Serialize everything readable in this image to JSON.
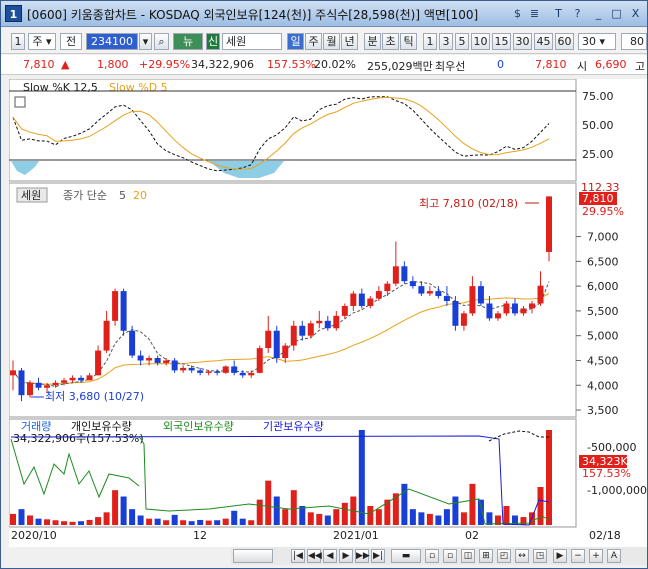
{
  "window": {
    "title": "[0600] 키움종합차트 - KOSDAQ 외국인보유[124(천)] 주식수[28,598(천)] 액면[100]",
    "buttons": [
      "$",
      "≣",
      "T",
      "?",
      "_",
      "□",
      "X"
    ]
  },
  "toolbar": {
    "num": "1",
    "type": "주",
    "type2": "전",
    "code": "234100",
    "flag": "뉴",
    "credit": "신",
    "name": "세원",
    "periods": [
      "일",
      "주",
      "월",
      "년",
      "분",
      "초",
      "틱"
    ],
    "intervals": [
      "1",
      "3",
      "5",
      "10",
      "15",
      "30",
      "45",
      "60"
    ],
    "count_value": "30",
    "display_value": "80"
  },
  "quote": {
    "price": "7,810",
    "arrow": "▲",
    "change": "1,800",
    "change_pct": "+29.95%",
    "volume": "34,322,906",
    "volume_pct": "157.53%",
    "turnover": "20.02%",
    "amount": "255,029백만",
    "priority_label": "최우선",
    "priority_value": "0",
    "ask": "7,810",
    "market_label": "시",
    "open": "6,690",
    "more_label": "고"
  },
  "stoch_panel": {
    "label_k": "Slow %K 12,5",
    "label_d": "Slow %D 5",
    "y_ticks": [
      "75.00",
      "50.00",
      "25.00"
    ]
  },
  "price_panel": {
    "stock_label": "세원",
    "ma_label": "종가 단순",
    "ma_num1": "5",
    "ma_num2": "20",
    "high_note": "최고 7,810 (02/18)",
    "low_note": "최저 3,680 (10/27)",
    "y_ticks": [
      "7,000",
      "6,500",
      "6,000",
      "5,500",
      "5,000",
      "4,500",
      "4,000",
      "3,500"
    ],
    "top_tick": "112.33",
    "last_price": "7,810",
    "last_pct": "29.95%"
  },
  "volume_panel": {
    "labels": [
      "거래량",
      "개인보유수량",
      "외국인보유수량",
      "기관보유수량"
    ],
    "label_colors": [
      "#1a62d6",
      "#111111",
      "#1d8a1d",
      "#1a1ad6"
    ],
    "vol_note": "34,322,906주(157.53%)",
    "y_ticks": [
      "-500,000",
      "-1,000,000"
    ],
    "last_vol": "34,323K",
    "last_pct": "157.53%"
  },
  "x_axis": {
    "labels": [
      "2020/10",
      "12",
      "2021/01",
      "02",
      "02/18"
    ]
  },
  "colors": {
    "up": "#e0201b",
    "down": "#1a3fd6",
    "ma5": "#444444",
    "ma20": "#e8a21a"
  },
  "chart_data": {
    "type": "candlestick",
    "candles": [
      [
        4200,
        4500,
        3900,
        4300
      ],
      [
        4300,
        4350,
        3680,
        3800
      ],
      [
        3800,
        4100,
        3750,
        4050
      ],
      [
        4050,
        4150,
        3900,
        3950
      ],
      [
        3950,
        4050,
        3850,
        4000
      ],
      [
        4000,
        4100,
        3950,
        4050
      ],
      [
        4050,
        4150,
        4000,
        4100
      ],
      [
        4100,
        4200,
        4050,
        4150
      ],
      [
        4150,
        4200,
        4050,
        4100
      ],
      [
        4100,
        4250,
        4100,
        4200
      ],
      [
        4200,
        4800,
        4200,
        4700
      ],
      [
        4700,
        5500,
        4650,
        5300
      ],
      [
        5300,
        5950,
        5200,
        5900
      ],
      [
        5900,
        5950,
        5000,
        5100
      ],
      [
        5100,
        5200,
        4550,
        4600
      ],
      [
        4600,
        4700,
        4400,
        4500
      ],
      [
        4500,
        4600,
        4400,
        4550
      ],
      [
        4550,
        4600,
        4400,
        4450
      ],
      [
        4450,
        4550,
        4400,
        4500
      ],
      [
        4500,
        4550,
        4250,
        4300
      ],
      [
        4300,
        4400,
        4250,
        4350
      ],
      [
        4350,
        4400,
        4250,
        4300
      ],
      [
        4300,
        4350,
        4200,
        4250
      ],
      [
        4250,
        4300,
        4200,
        4280
      ],
      [
        4280,
        4320,
        4200,
        4250
      ],
      [
        4250,
        4400,
        4230,
        4380
      ],
      [
        4380,
        4500,
        4200,
        4250
      ],
      [
        4250,
        4300,
        4150,
        4200
      ],
      [
        4200,
        4300,
        4150,
        4250
      ],
      [
        4250,
        4800,
        4240,
        4750
      ],
      [
        4750,
        5400,
        4650,
        5100
      ],
      [
        5100,
        5200,
        4450,
        4550
      ],
      [
        4550,
        4850,
        4450,
        4800
      ],
      [
        4800,
        5300,
        4700,
        5200
      ],
      [
        5200,
        5300,
        4900,
        5000
      ],
      [
        5000,
        5300,
        4950,
        5250
      ],
      [
        5250,
        5500,
        5150,
        5300
      ],
      [
        5300,
        5400,
        5100,
        5150
      ],
      [
        5150,
        5500,
        5100,
        5400
      ],
      [
        5400,
        5650,
        5350,
        5600
      ],
      [
        5600,
        5900,
        5500,
        5850
      ],
      [
        5850,
        5950,
        5550,
        5600
      ],
      [
        5600,
        5800,
        5550,
        5750
      ],
      [
        5750,
        6000,
        5700,
        5900
      ],
      [
        5900,
        6100,
        5800,
        6050
      ],
      [
        6050,
        6900,
        6000,
        6400
      ],
      [
        6400,
        6500,
        6050,
        6100
      ],
      [
        6100,
        6200,
        5950,
        6000
      ],
      [
        6000,
        6100,
        5800,
        5850
      ],
      [
        5850,
        6000,
        5800,
        5900
      ],
      [
        5900,
        6000,
        5750,
        5800
      ],
      [
        5800,
        6000,
        5600,
        5700
      ],
      [
        5700,
        5800,
        5100,
        5200
      ],
      [
        5200,
        5500,
        5100,
        5450
      ],
      [
        5450,
        6200,
        5400,
        6000
      ],
      [
        6000,
        6100,
        5600,
        5650
      ],
      [
        5650,
        5800,
        5300,
        5350
      ],
      [
        5350,
        5500,
        5300,
        5450
      ],
      [
        5450,
        5700,
        5400,
        5650
      ],
      [
        5650,
        5750,
        5400,
        5450
      ],
      [
        5450,
        5600,
        5400,
        5550
      ],
      [
        5550,
        5700,
        5450,
        5650
      ],
      [
        5650,
        6300,
        5600,
        6010
      ],
      [
        6690,
        7810,
        6500,
        7810
      ]
    ],
    "volume": [
      3.5,
      5,
      3,
      2,
      1.8,
      1.5,
      1.2,
      1,
      1.2,
      1.6,
      2.5,
      4,
      11,
      9,
      5,
      3,
      2,
      2,
      1.5,
      3.2,
      1.5,
      1.2,
      1.6,
      1.4,
      1.5,
      2,
      4.5,
      2,
      1.5,
      8,
      14,
      9,
      5,
      11,
      6,
      4,
      3.5,
      3,
      5,
      7,
      9,
      30,
      6,
      5,
      8,
      10,
      13,
      5,
      4,
      3.5,
      3,
      5,
      9,
      4,
      13,
      8,
      4,
      3,
      6,
      3,
      2.5,
      4,
      12,
      30
    ],
    "ylim": [
      3400,
      8000
    ]
  }
}
